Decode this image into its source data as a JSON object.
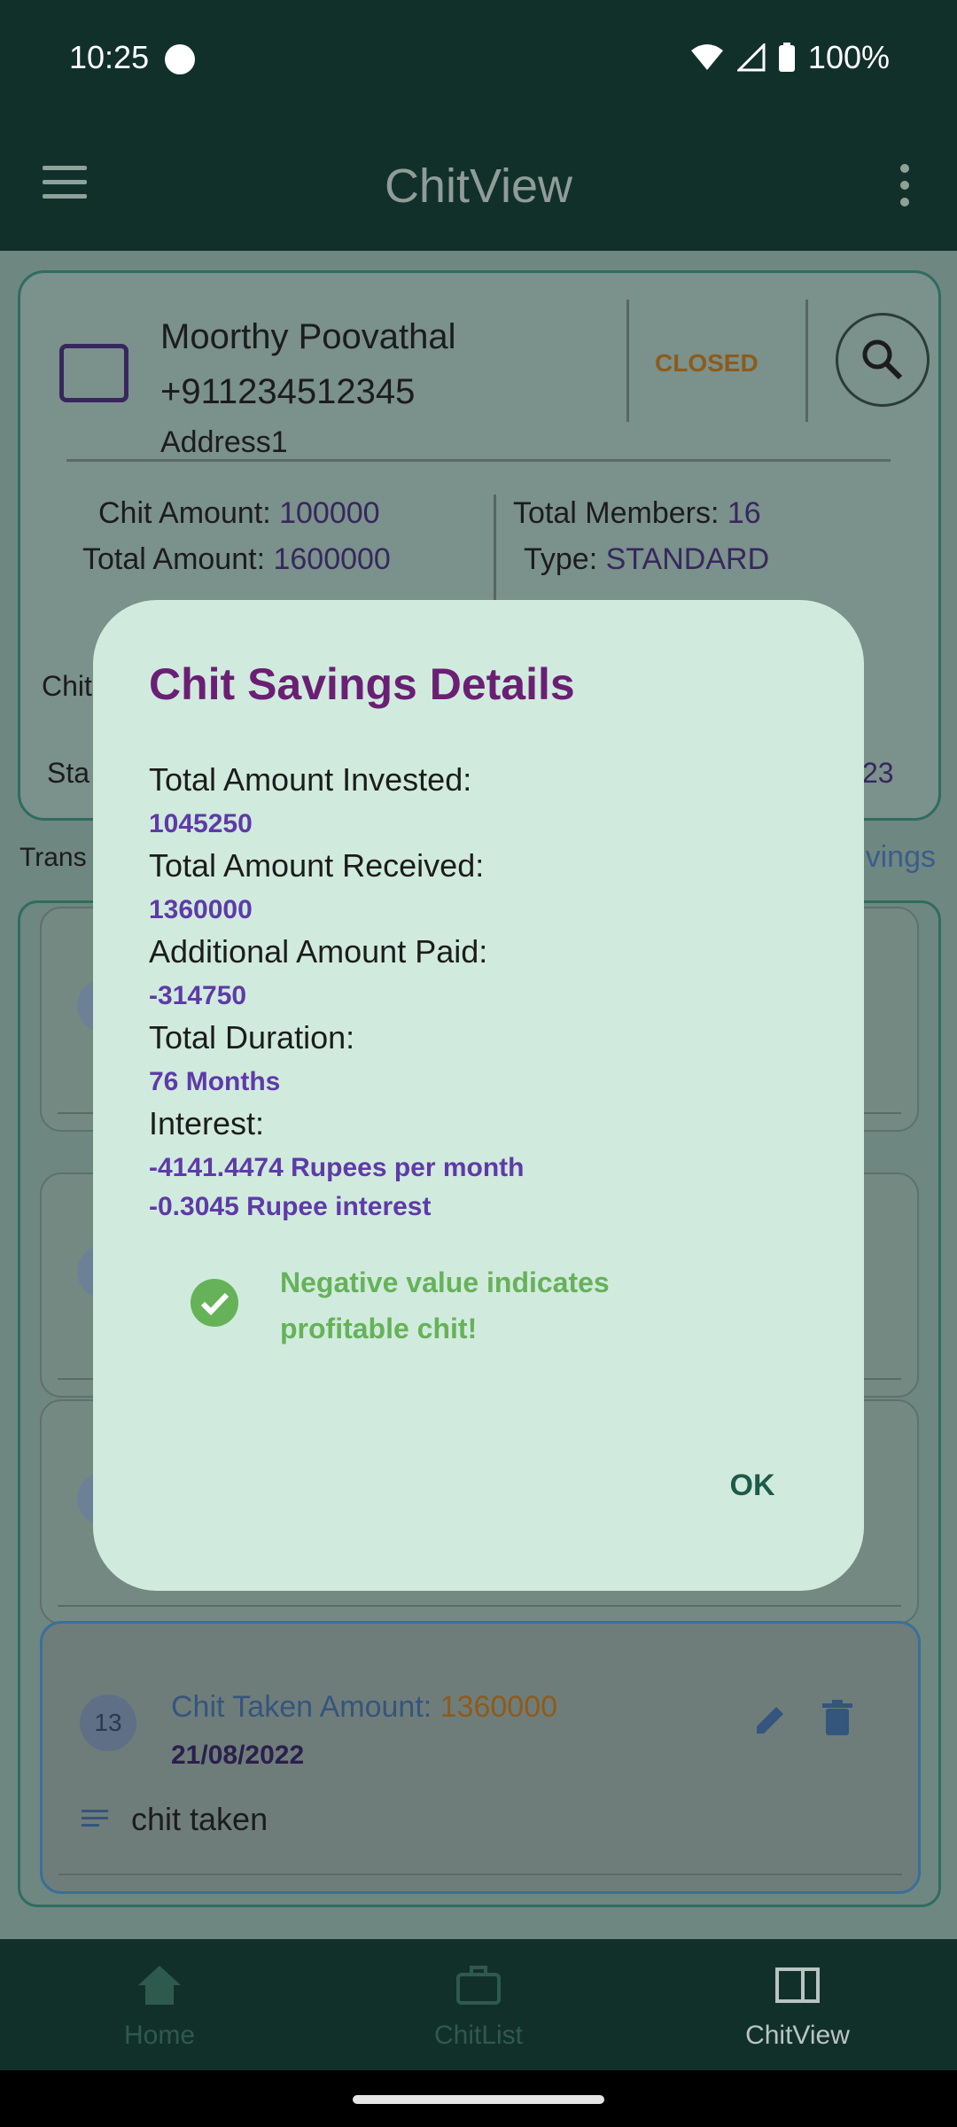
{
  "status_bar": {
    "time": "10:25",
    "battery": "100%"
  },
  "app_bar": {
    "title": "ChitView"
  },
  "member": {
    "name": "Moorthy Poovathal",
    "phone": "+911234512345",
    "address": "Address1",
    "status": "CLOSED"
  },
  "summary": {
    "chit_amount_label": "Chit Amount:",
    "chit_amount": "100000",
    "total_amount_label": "Total Amount:",
    "total_amount": "1600000",
    "total_members_label": "Total Members:",
    "total_members": "16",
    "type_label": "Type:",
    "type": "STANDARD",
    "partial_chit": "Chit",
    "partial_start": "Sta",
    "partial_date_end": "23",
    "partial_transactions": "Trans",
    "partial_savings_link": "vings"
  },
  "list": {
    "item_13": {
      "badge": "13",
      "label": "Chit Taken Amount: ",
      "amount": "1360000",
      "date": "21/08/2022",
      "note": "chit taken"
    }
  },
  "dialog": {
    "title": "Chit Savings Details",
    "invested_label": "Total Amount Invested:",
    "invested_value": "1045250",
    "received_label": "Total Amount Received:",
    "received_value": "1360000",
    "additional_label": "Additional Amount Paid:",
    "additional_value": "-314750",
    "duration_label": "Total Duration:",
    "duration_value": "76 Months",
    "interest_label": "Interest:",
    "interest_per_month": "-4141.4474 Rupees per month",
    "interest_rupee": "-0.3045 Rupee interest",
    "note": "Negative value indicates profitable chit!",
    "ok_label": "OK"
  },
  "bottom_nav": [
    {
      "label": "Home",
      "icon": "home-icon"
    },
    {
      "label": "ChitList",
      "icon": "briefcase-icon"
    },
    {
      "label": "ChitView",
      "icon": "view-icon"
    }
  ],
  "colors": {
    "dialog_bg": "#d0ebde",
    "title": "#6b1f74",
    "value": "#5f3aa8",
    "success": "#66b258",
    "appbar": "#12302a"
  }
}
